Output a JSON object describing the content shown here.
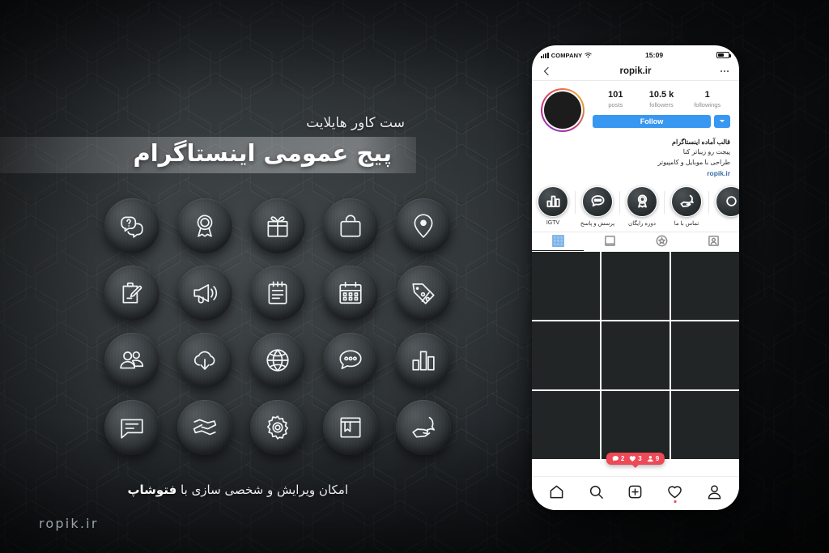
{
  "poster": {
    "headline_sub": "ست کاور هایلایت",
    "headline_main": "پیج عمومی اینستاگرام",
    "caption_prefix": "امکان ویرایش و شخصی سازی با ",
    "caption_bold": "فتوشاپ",
    "watermark": "ropik.ir",
    "background": "#2b2f31",
    "accent": "#3897f0"
  },
  "icon_grid": {
    "rows": 4,
    "cols": 5,
    "items": [
      {
        "name": "question-chat-icon"
      },
      {
        "name": "award-ribbon-icon"
      },
      {
        "name": "gift-icon"
      },
      {
        "name": "shopping-bag-icon"
      },
      {
        "name": "location-pin-icon"
      },
      {
        "name": "edit-clipboard-icon"
      },
      {
        "name": "megaphone-icon"
      },
      {
        "name": "notepad-icon"
      },
      {
        "name": "calendar-icon"
      },
      {
        "name": "discount-tag-icon"
      },
      {
        "name": "people-group-icon"
      },
      {
        "name": "cloud-download-icon"
      },
      {
        "name": "globe-icon"
      },
      {
        "name": "chat-dots-icon"
      },
      {
        "name": "bar-chart-icon"
      },
      {
        "name": "speech-lines-icon"
      },
      {
        "name": "handshake-icon"
      },
      {
        "name": "gear-icon"
      },
      {
        "name": "book-icon"
      },
      {
        "name": "hand-phone-icon"
      }
    ]
  },
  "phone": {
    "status_bar": {
      "carrier": "COMPANY",
      "time": "15:09",
      "signal_icon": "signal-bars-icon",
      "wifi_icon": "wifi-icon",
      "battery_icon": "battery-icon"
    },
    "header": {
      "back_icon": "back-chevron-icon",
      "title": "ropik.ir",
      "more_icon": "more-dots-icon"
    },
    "profile": {
      "avatar_name": "avatar",
      "stats": [
        {
          "value": "101",
          "label": "posts"
        },
        {
          "value": "10.5 k",
          "label": "followers"
        },
        {
          "value": "1",
          "label": "followings"
        }
      ],
      "follow_label": "Follow",
      "caret_icon": "chevron-down-icon"
    },
    "bio": {
      "line1": "قالب آماده اینستاگرام",
      "line2": "پیجت رو زیباتر کنا",
      "line3": "طراحی با موبایل و کامپیوتر",
      "link": "ropik.ir"
    },
    "highlights": [
      {
        "label": "IGTV",
        "icon": "bar-chart-icon"
      },
      {
        "label": "پرسش و پاسخ",
        "icon": "chat-dots-icon"
      },
      {
        "label": "دوره رایگان",
        "icon": "award-ribbon-icon"
      },
      {
        "label": "تماس با ما",
        "icon": "hand-phone-icon"
      },
      {
        "label": "",
        "icon": "more-highlight-icon"
      }
    ],
    "tabs": [
      {
        "name": "tab-grid",
        "icon": "grid-icon",
        "active": true
      },
      {
        "name": "tab-list",
        "icon": "list-card-icon",
        "active": false
      },
      {
        "name": "tab-saved",
        "icon": "star-circle-icon",
        "active": false
      },
      {
        "name": "tab-tagged",
        "icon": "person-card-icon",
        "active": false
      }
    ],
    "grid_cells": 9,
    "engagement_badge": {
      "comments": "2",
      "likes": "3",
      "followers": "9",
      "color": "#ed4956"
    },
    "tabbar": [
      {
        "name": "nav-home",
        "icon": "home-icon"
      },
      {
        "name": "nav-search",
        "icon": "search-icon"
      },
      {
        "name": "nav-add",
        "icon": "plus-box-icon"
      },
      {
        "name": "nav-activity",
        "icon": "heart-icon"
      },
      {
        "name": "nav-profile",
        "icon": "person-icon"
      }
    ]
  }
}
